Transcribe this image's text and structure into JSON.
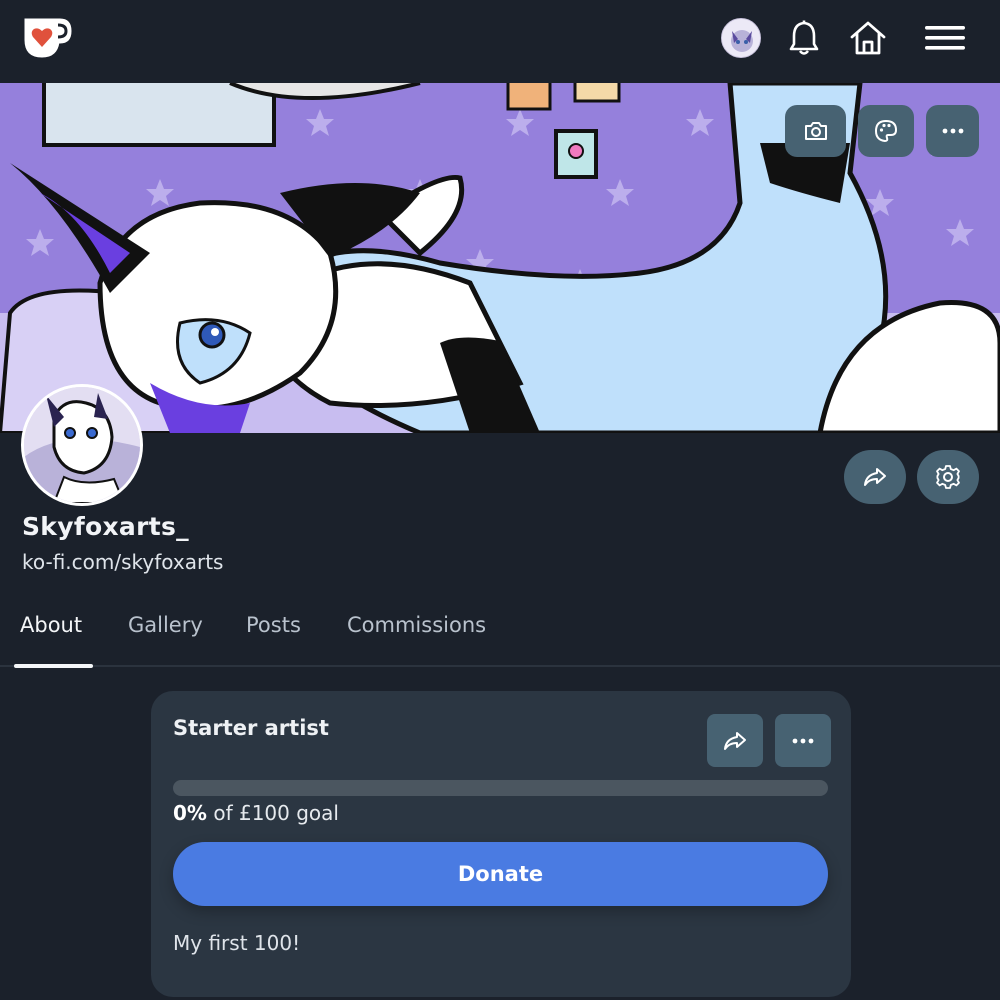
{
  "nav": {
    "icons": [
      "kofi-cup-logo-icon",
      "user-avatar",
      "bell-icon",
      "home-icon",
      "hamburger-menu-icon"
    ]
  },
  "banner": {
    "buttons": [
      "camera-icon",
      "palette-icon",
      "more-icon"
    ]
  },
  "profile": {
    "name": "Skyfoxarts_",
    "url": "ko-fi.com/skyfoxarts",
    "actions": [
      "share-icon",
      "gear-icon"
    ]
  },
  "tabs": {
    "about": "About",
    "gallery": "Gallery",
    "posts": "Posts",
    "commissions": "Commissions",
    "active": "About"
  },
  "goal": {
    "title": "Starter artist",
    "percent_label": "0%",
    "goal_suffix": "of £100 goal",
    "progress_fraction": 0,
    "donate_label": "Donate",
    "description": "My first 100!"
  },
  "colors": {
    "background": "#1b212b",
    "card": "#2b3642",
    "button": "#476272",
    "accent": "#4a7be2",
    "kofi_red": "#e0513c"
  }
}
